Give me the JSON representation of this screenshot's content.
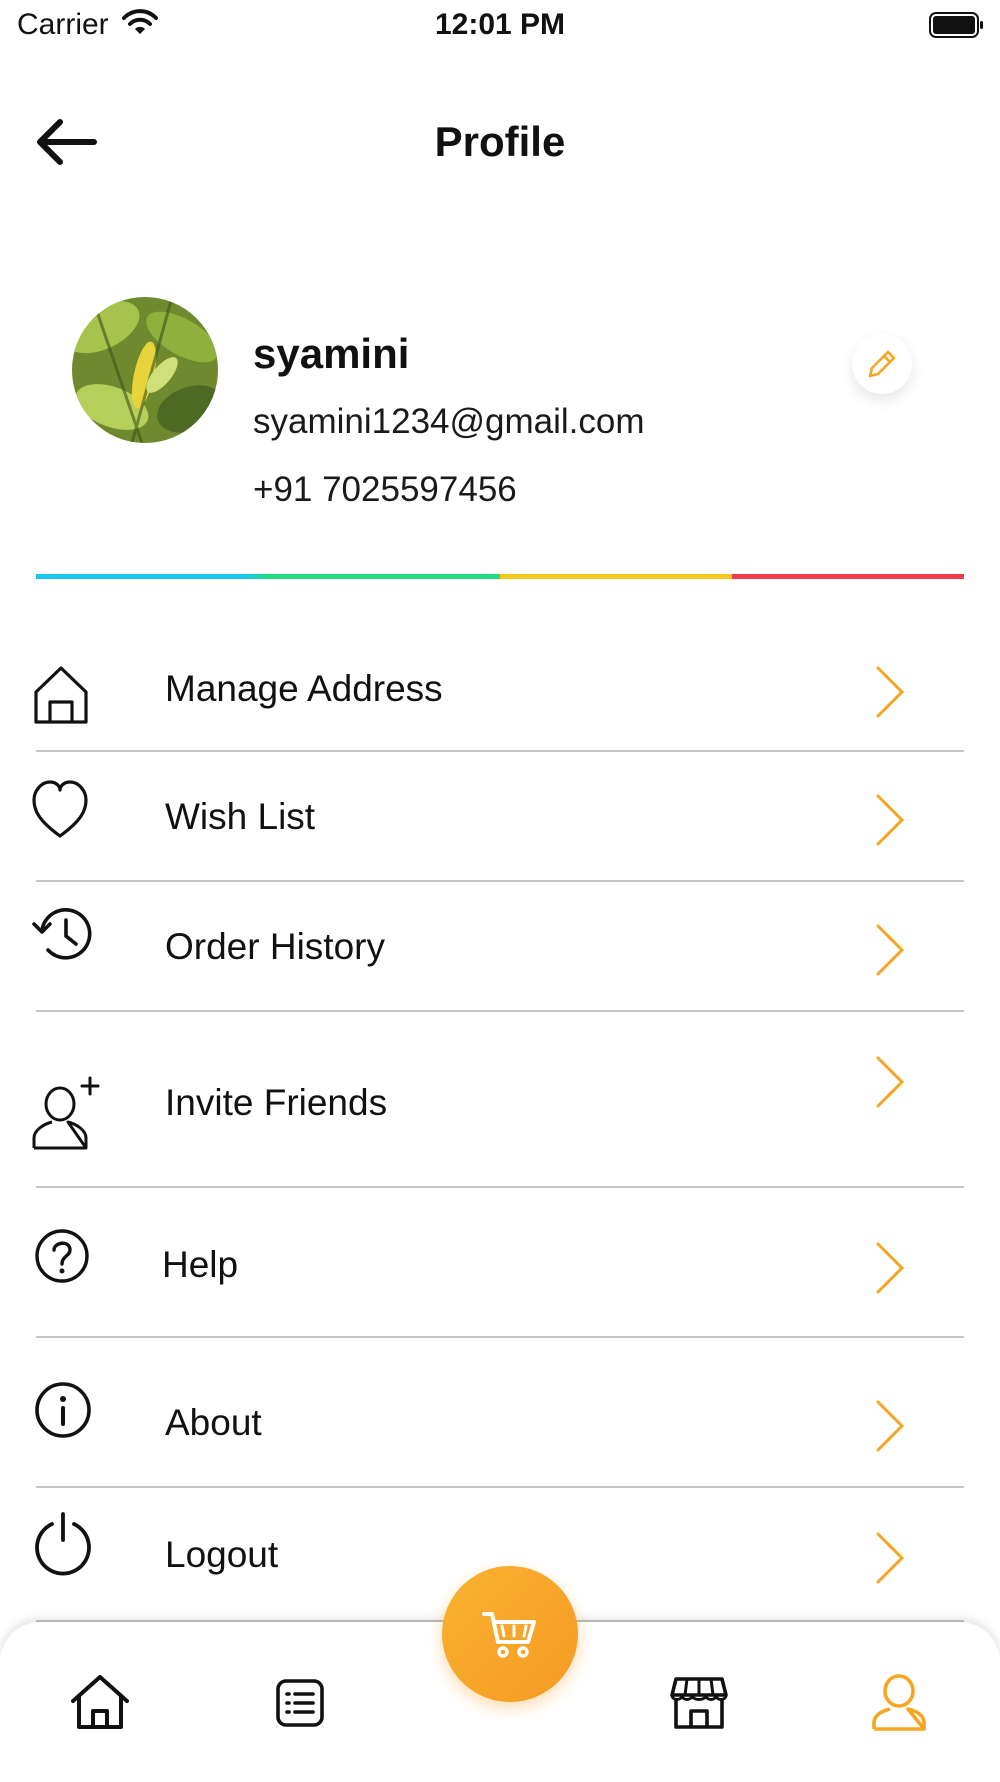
{
  "status_bar": {
    "carrier": "Carrier",
    "time": "12:01 PM"
  },
  "header": {
    "title": "Profile",
    "back_icon": "arrow-left-icon"
  },
  "profile": {
    "name": "syamini",
    "email": "syamini1234@gmail.com",
    "phone": "+91 7025597456",
    "edit_icon": "pencil-icon"
  },
  "accent_bar_colors": [
    "#1bc6ef",
    "#21dc83",
    "#f7c81c",
    "#ef3d4e"
  ],
  "colors": {
    "accent": "#f5a623",
    "divider": "#c6c6c6",
    "text": "#111111"
  },
  "menu": [
    {
      "label": "Manage Address",
      "icon": "home-icon"
    },
    {
      "label": "Wish List",
      "icon": "heart-icon"
    },
    {
      "label": "Order History",
      "icon": "history-icon"
    },
    {
      "label": "Invite Friends",
      "icon": "add-user-icon"
    },
    {
      "label": "Help",
      "icon": "help-icon"
    },
    {
      "label": "About",
      "icon": "info-icon"
    },
    {
      "label": "Logout",
      "icon": "power-icon"
    }
  ],
  "bottom_nav": {
    "items": [
      "home-icon",
      "list-icon",
      "cart-icon",
      "store-icon",
      "profile-icon"
    ],
    "active": "profile-icon"
  }
}
